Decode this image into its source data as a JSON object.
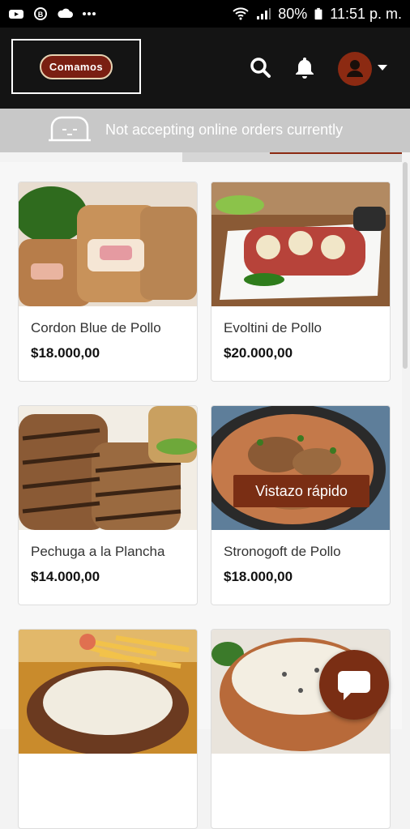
{
  "status_bar": {
    "battery": "80%",
    "time": "11:51 p. m."
  },
  "header": {
    "logo_text": "Comamos"
  },
  "notice": {
    "text": "Not accepting online orders currently"
  },
  "products": [
    {
      "name": "Cordon Blue de Pollo",
      "price": "$18.000,00"
    },
    {
      "name": "Evoltini de Pollo",
      "price": "$20.000,00"
    },
    {
      "name": "Pechuga a la Plancha",
      "price": "$14.000,00"
    },
    {
      "name": "Stronogoft de Pollo",
      "price": "$18.000,00",
      "quick_view": "Vistazo rápido"
    }
  ],
  "colors": {
    "brand": "#7a2e14",
    "header_bg": "#141414",
    "notice_bg": "#c8c8c8"
  }
}
